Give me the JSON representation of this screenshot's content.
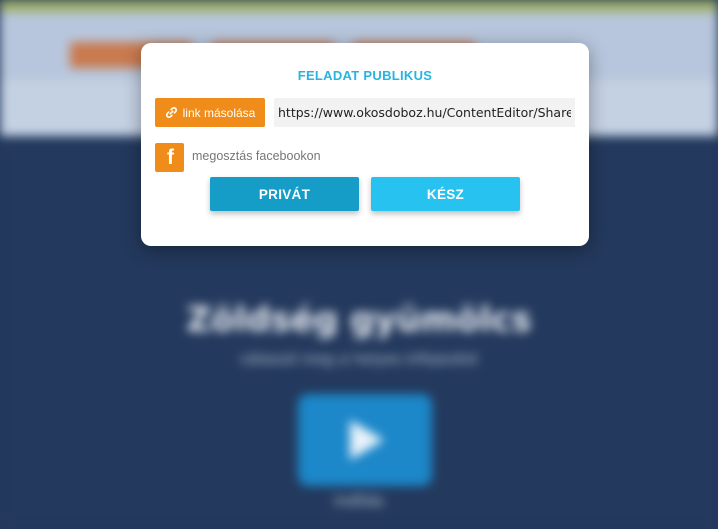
{
  "background": {
    "title": "Zöldség gyümölcs",
    "subtitle": "válaszd meg a helyes kifejezést",
    "play_caption": "indítás"
  },
  "modal": {
    "title": "FELADAT PUBLIKUS",
    "copy_link_label": "link másolása",
    "share_url": "https://www.okosdoboz.hu/ContentEditor/SharedContent",
    "facebook_icon_glyph": "f",
    "facebook_share_label": "megosztás facebookon",
    "private_button_label": "PRIVÁT",
    "done_button_label": "KÉSZ"
  },
  "colors": {
    "accent_orange": "#f08c1a",
    "title_blue": "#27b5e0",
    "private_blue": "#159dc8",
    "done_blue": "#27c2ef",
    "page_background": "#23395d"
  }
}
